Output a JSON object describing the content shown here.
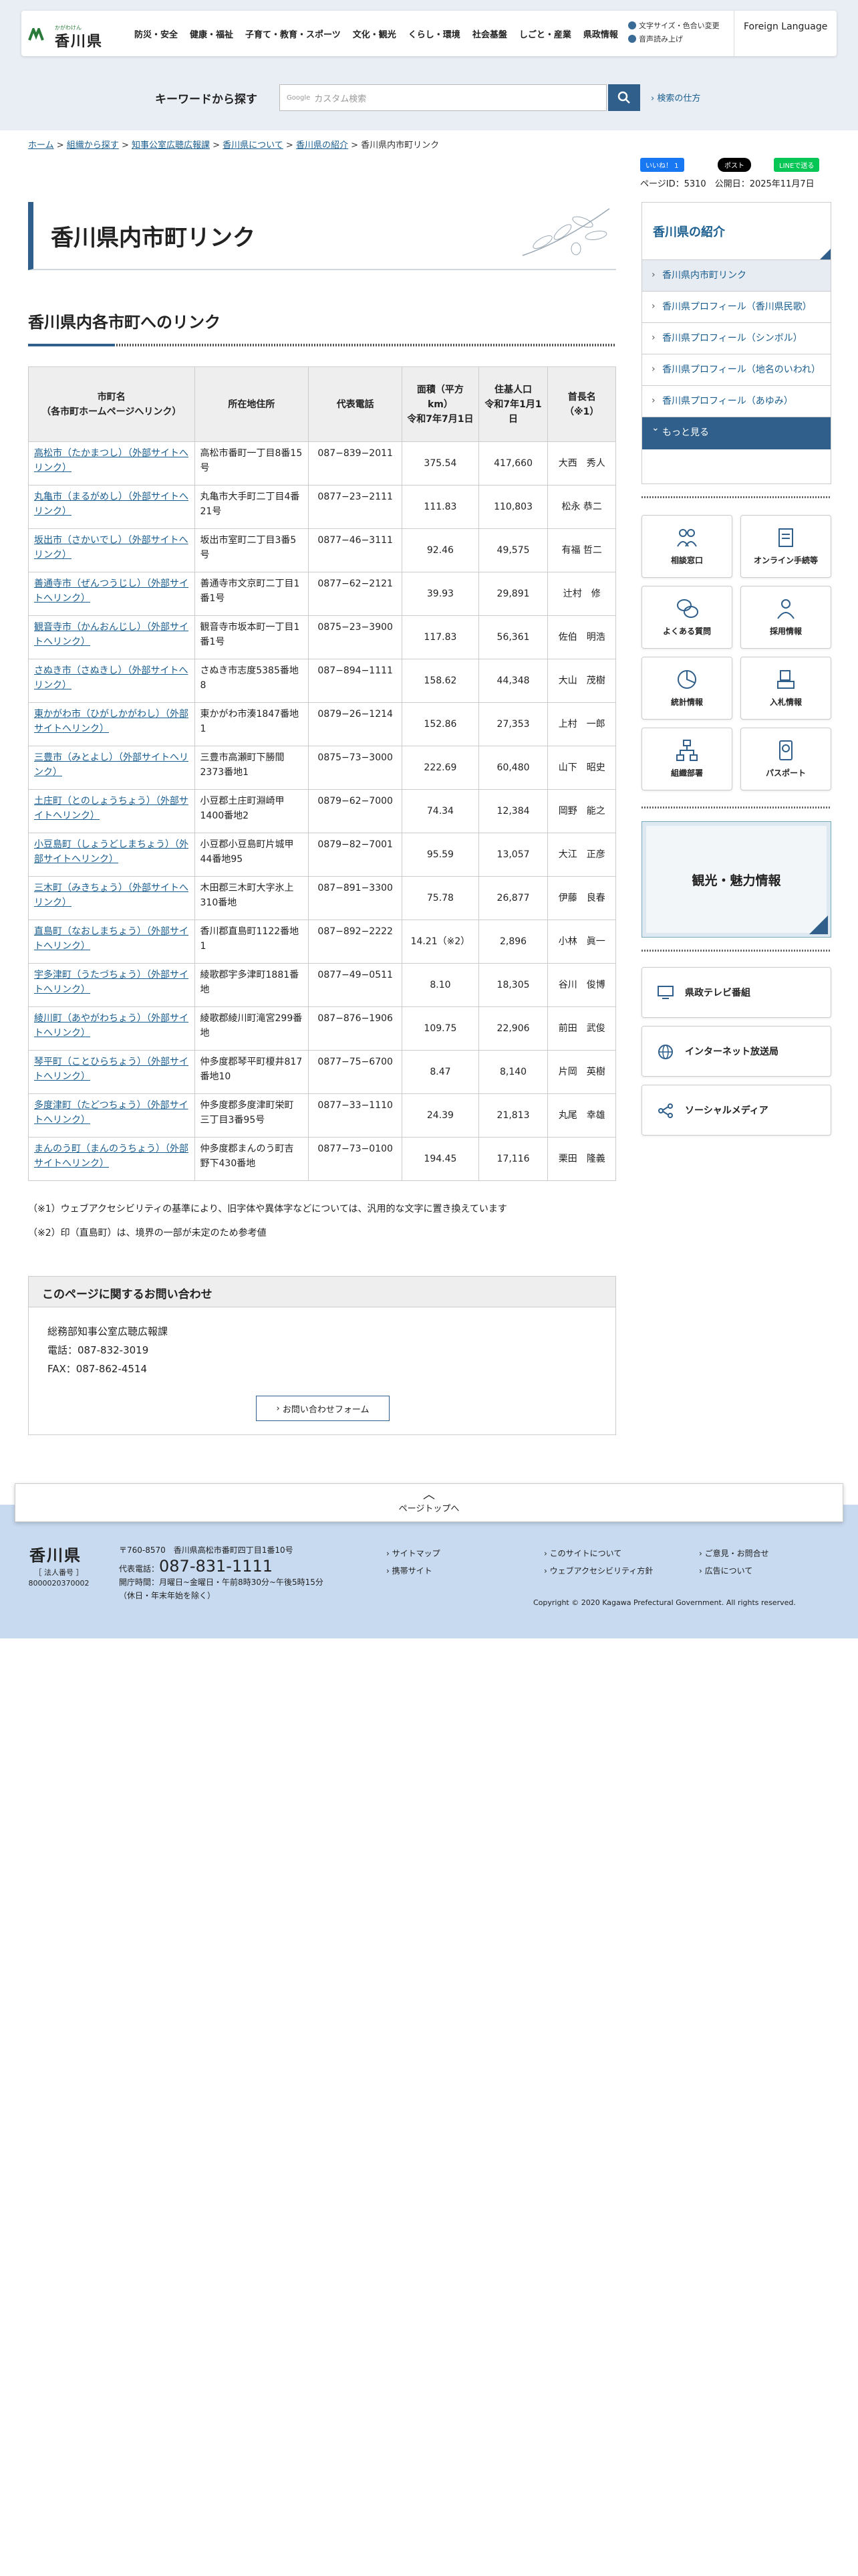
{
  "header": {
    "logo_tagline": "かがわけん",
    "logo_name": "香川県",
    "nav": [
      "防災・安全",
      "健康・福祉",
      "子育て・教育・スポーツ",
      "文化・観光",
      "くらし・環境",
      "社会基盤",
      "しごと・産業",
      "県政情報"
    ],
    "util_color": "文字サイズ・色合い変更",
    "util_read": "音声読み上げ",
    "foreign": "Foreign Language"
  },
  "search": {
    "label": "キーワードから探す",
    "google": "Google",
    "placeholder": "カスタム検索",
    "help": "検索の仕方"
  },
  "breadcrumb": [
    "ホーム",
    "組織から探す",
    "知事公室広聴広報課",
    "香川県について",
    "香川県の紹介",
    "香川県内市町リンク"
  ],
  "social": {
    "facebook": "いいね！ 1",
    "x": "ポスト",
    "line": "LINEで送る"
  },
  "meta": {
    "page_id": "ページID：5310",
    "published": "公開日：2025年11月7日"
  },
  "title": "香川県内市町リンク",
  "section_title": "香川県内各市町へのリンク",
  "table": {
    "headers": [
      "市町名\n（各市町ホームページへリンク）",
      "所在地住所",
      "代表電話",
      "面積（平方km）\n令和7年7月1日",
      "住基人口\n令和7年1月1日",
      "首長名\n（※1）"
    ],
    "rows": [
      [
        "高松市（たかまつし）（外部サイトへリンク）",
        "高松市番町一丁目8番15号",
        "087−839−2011",
        "375.54",
        "417,660",
        "大西　秀人"
      ],
      [
        "丸亀市（まるがめし）（外部サイトへリンク）",
        "丸亀市大手町二丁目4番21号",
        "0877−23−2111",
        "111.83",
        "110,803",
        "松永 恭二"
      ],
      [
        "坂出市（さかいでし）（外部サイトへリンク）",
        "坂出市室町二丁目3番5号",
        "0877−46−3111",
        "92.46",
        "49,575",
        "有福 哲二"
      ],
      [
        "善通寺市（ぜんつうじし）（外部サイトへリンク）",
        "善通寺市文京町二丁目1番1号",
        "0877−62−2121",
        "39.93",
        "29,891",
        "辻村　修"
      ],
      [
        "観音寺市（かんおんじし）（外部サイトへリンク）",
        "観音寺市坂本町一丁目1番1号",
        "0875−23−3900",
        "117.83",
        "56,361",
        "佐伯　明浩"
      ],
      [
        "さぬき市（さぬきし）（外部サイトへリンク）",
        "さぬき市志度5385番地8",
        "087−894−1111",
        "158.62",
        "44,348",
        "大山　茂樹"
      ],
      [
        "東かがわ市（ひがしかがわし）（外部サイトへリンク）",
        "東かがわ市湊1847番地1",
        "0879−26−1214",
        "152.86",
        "27,353",
        "上村　一郎"
      ],
      [
        "三豊市（みとよし）（外部サイトへリンク）",
        "三豊市高瀬町下勝間2373番地1",
        "0875−73−3000",
        "222.69",
        "60,480",
        "山下　昭史"
      ],
      [
        "土庄町（とのしょうちょう）（外部サイトへリンク）",
        "小豆郡土庄町淵崎甲1400番地2",
        "0879−62−7000",
        "74.34",
        "12,384",
        "岡野　能之"
      ],
      [
        "小豆島町（しょうどしまちょう）（外部サイトへリンク）",
        "小豆郡小豆島町片城甲44番地95",
        "0879−82−7001",
        "95.59",
        "13,057",
        "大江　正彦"
      ],
      [
        "三木町（みきちょう）（外部サイトへリンク）",
        "木田郡三木町大字氷上310番地",
        "087−891−3300",
        "75.78",
        "26,877",
        "伊藤　良春"
      ],
      [
        "直島町（なおしまちょう）（外部サイトへリンク）",
        "香川郡直島町1122番地1",
        "087−892−2222",
        "14.21（※2）",
        "2,896",
        "小林　眞一"
      ],
      [
        "宇多津町（うたづちょう）（外部サイトへリンク）",
        "綾歌郡宇多津町1881番地",
        "0877−49−0511",
        "8.10",
        "18,305",
        "谷川　俊博"
      ],
      [
        "綾川町（あやがわちょう）（外部サイトへリンク）",
        "綾歌郡綾川町滝宮299番地",
        "087−876−1906",
        "109.75",
        "22,906",
        "前田　武俊"
      ],
      [
        "琴平町（ことひらちょう）（外部サイトへリンク）",
        "仲多度郡琴平町榎井817番地10",
        "0877−75−6700",
        "8.47",
        "8,140",
        "片岡　英樹"
      ],
      [
        "多度津町（たどつちょう）（外部サイトへリンク）",
        "仲多度郡多度津町栄町三丁目3番95号",
        "0877−33−1110",
        "24.39",
        "21,813",
        "丸尾　幸雄"
      ],
      [
        "まんのう町（まんのうちょう）（外部サイトへリンク）",
        "仲多度郡まんのう町吉野下430番地",
        "0877−73−0100",
        "194.45",
        "17,116",
        "栗田　隆義"
      ]
    ]
  },
  "notes": [
    "（※1）ウェブアクセシビリティの基準により、旧字体や異体字などについては、汎用的な文字に置き換えています",
    "（※2）印（直島町）は、境界の一部が未定のため参考値"
  ],
  "contact": {
    "title": "このページに関するお問い合わせ",
    "dept": "総務部知事公室広聴広報課",
    "tel": "電話：087-832-3019",
    "fax": "FAX：087-862-4514",
    "form": "お問い合わせフォーム"
  },
  "sidebar": {
    "title": "香川県の紹介",
    "items": [
      "香川県内市町リンク",
      "香川県プロフィール（香川県民歌）",
      "香川県プロフィール（シンボル）",
      "香川県プロフィール（地名のいわれ）",
      "香川県プロフィール（あゆみ）"
    ],
    "more": "もっと見る",
    "quick": [
      "相談窓口",
      "オンライン手続等",
      "よくある質問",
      "採用情報",
      "統計情報",
      "入札情報",
      "組織部署",
      "パスポート"
    ],
    "banner": "観光・魅力情報",
    "links": [
      "県政テレビ番組",
      "インターネット放送局",
      "ソーシャルメディア"
    ]
  },
  "pagetop": "ページトップへ",
  "footer": {
    "name": "香川県",
    "corp": "［ 法人番号 ］\n8000020370002",
    "address": "〒760-8570　香川県高松市番町四丁目1番10号",
    "tel_label": "代表電話：",
    "tel": "087-831-1111",
    "hours": "開庁時間：月曜日~金曜日・午前8時30分~午後5時15分",
    "closed": "（休日・年末年始を除く）",
    "links_a": [
      "サイトマップ",
      "携帯サイト"
    ],
    "links_b": [
      "このサイトについて",
      "ウェブアクセシビリティ方針"
    ],
    "links_c": [
      "ご意見・お問合せ",
      "広告について"
    ],
    "copyright": "Copyright © 2020 Kagawa Prefectural Government. All rights reserved."
  }
}
